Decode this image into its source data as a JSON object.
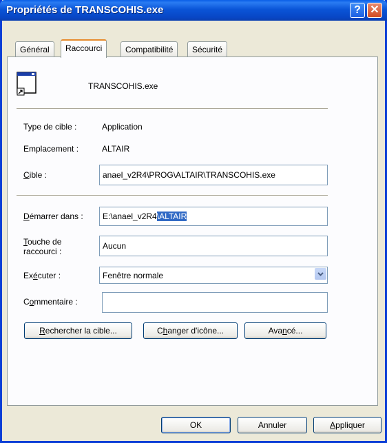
{
  "window": {
    "title": "Propriétés de TRANSCOHIS.exe",
    "help_label": "?",
    "close_label": "✕"
  },
  "tabs": [
    {
      "label": "Général",
      "active": false
    },
    {
      "label": "Raccourci",
      "active": true
    },
    {
      "label": "Compatibilité",
      "active": false
    },
    {
      "label": "Sécurité",
      "active": false
    }
  ],
  "shortcut": {
    "file_name": "TRANSCOHIS.exe",
    "target_type_label": "Type de cible :",
    "target_type_value": "Application",
    "location_label": "Emplacement :",
    "location_value": "ALTAIR",
    "target_label_u": "C",
    "target_label_rest": "ible :",
    "target_value": "anael_v2R4\\PROG\\ALTAIR\\TRANSCOHIS.exe",
    "start_in_label_u": "D",
    "start_in_label_rest": "émarrer dans :",
    "start_in_value_plain": "E:\\anael_v2R4",
    "start_in_value_selected": "\\ALTAIR",
    "hotkey_label_u": "T",
    "hotkey_label_rest": "ouche de",
    "hotkey_label_line2": "raccourci :",
    "hotkey_value": "Aucun",
    "run_label_pre": "Ex",
    "run_label_u": "é",
    "run_label_rest": "cuter :",
    "run_value": "Fenêtre normale",
    "comment_label_pre": "C",
    "comment_label_u": "o",
    "comment_label_rest": "mmentaire :",
    "comment_value": ""
  },
  "buttons": {
    "find_target_u": "R",
    "find_target_rest": "echercher la cible...",
    "change_icon_pre": "C",
    "change_icon_u": "h",
    "change_icon_rest": "anger d'icône...",
    "advanced_pre": "Ava",
    "advanced_u": "n",
    "advanced_rest": "cé...",
    "ok": "OK",
    "cancel": "Annuler",
    "apply_u": "A",
    "apply_rest": "ppliquer"
  }
}
